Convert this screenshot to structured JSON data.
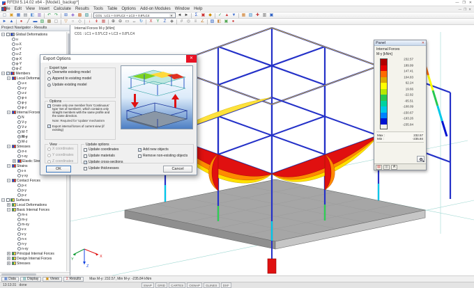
{
  "window": {
    "title": "RFEM 5.14.02 x64 - [Model1_backup*]",
    "minimize": "—",
    "maximize": "❐",
    "close": "✕"
  },
  "menu": {
    "items": [
      "File",
      "Edit",
      "View",
      "Insert",
      "Calculate",
      "Results",
      "Tools",
      "Table",
      "Options",
      "Add-on Modules",
      "Window",
      "Help"
    ]
  },
  "toolbar1_left": [
    {
      "n": "new-file",
      "g": "▢",
      "c": "#7d8da0"
    },
    {
      "n": "open-file",
      "g": "▣",
      "c": "#d99e2b"
    },
    {
      "n": "save-file",
      "g": "▦",
      "c": "#2f62c4"
    },
    {
      "n": "print",
      "g": "▤",
      "c": "#6f7780"
    },
    {
      "n": "copy",
      "g": "◧",
      "c": "#5b8fd4"
    },
    {
      "n": "paste",
      "g": "▥",
      "c": "#8c6fc4"
    },
    {
      "n": "sep"
    },
    {
      "n": "undo",
      "g": "↶",
      "c": "#2e9e4f"
    },
    {
      "n": "redo",
      "g": "↷",
      "c": "#2e9e4f"
    },
    {
      "n": "sep"
    },
    {
      "n": "new-model",
      "g": "⊞",
      "c": "#2f62c4"
    },
    {
      "n": "render-mode",
      "g": "◈",
      "c": "#7a52cc"
    },
    {
      "n": "tables",
      "g": "▩",
      "c": "#cf6a2e"
    },
    {
      "n": "display-properties",
      "g": "▨",
      "c": "#2e8f8f"
    },
    {
      "n": "sep"
    }
  ],
  "toolbar1": {
    "load_case": "CO1 : LC1 + 0.5*LC2 + LC3 + 0.8*LC4"
  },
  "toolbar1_right": [
    {
      "n": "previous-load-case",
      "g": "◄",
      "c": "#444444"
    },
    {
      "n": "next-load-case",
      "g": "►",
      "c": "#444444"
    },
    {
      "n": "sep"
    },
    {
      "n": "calculate",
      "g": "Σ",
      "c": "#2255cc"
    },
    {
      "n": "show-results",
      "g": "▣",
      "c": "#cc3333"
    },
    {
      "n": "show-loads",
      "g": "◆",
      "c": "#cc8800"
    },
    {
      "n": "sep"
    },
    {
      "n": "apply-results",
      "g": "✓",
      "c": "#2e9e4f"
    },
    {
      "n": "increase-values",
      "g": "▲",
      "c": "#d04040"
    },
    {
      "n": "decrease-values",
      "g": "▼",
      "c": "#4070d0"
    },
    {
      "n": "sep"
    },
    {
      "n": "panel-toggle",
      "g": "▦",
      "c": "#d08030"
    },
    {
      "n": "legend-toggle",
      "g": "▧",
      "c": "#4090d0"
    },
    {
      "n": "add-on-modules",
      "g": "✚",
      "c": "#c03030"
    },
    {
      "n": "misc-options",
      "g": "▥",
      "c": "#666666"
    },
    {
      "n": "help-tool",
      "g": "▣",
      "c": "#2f62c4"
    }
  ],
  "toolbar2": [
    {
      "n": "select-arrow",
      "g": "►",
      "c": "#2f62c4"
    },
    {
      "n": "select-special",
      "g": "▲",
      "c": "#2f62c4"
    },
    {
      "n": "sep"
    },
    {
      "n": "new-node",
      "g": "●",
      "c": "#cc4444"
    },
    {
      "n": "new-line",
      "g": "╱",
      "c": "#555555"
    },
    {
      "n": "new-member",
      "g": "▬",
      "c": "#2f62c4"
    },
    {
      "n": "new-surface",
      "g": "▧",
      "c": "#2e9e4f"
    },
    {
      "n": "new-solid",
      "g": "▩",
      "c": "#8a6f3a"
    },
    {
      "n": "new-opening",
      "g": "▢",
      "c": "#888888"
    },
    {
      "n": "sep"
    },
    {
      "n": "new-support",
      "g": "▽",
      "c": "#c87f2e"
    },
    {
      "n": "new-hinge",
      "g": "○",
      "c": "#777777"
    },
    {
      "n": "eccentricity",
      "g": "◇",
      "c": "#777777"
    },
    {
      "n": "sep"
    },
    {
      "n": "nodal-load",
      "g": "↓",
      "c": "#cc2222"
    },
    {
      "n": "member-load",
      "g": "↡",
      "c": "#cc2222"
    },
    {
      "n": "area-load",
      "g": "▦",
      "c": "#cc6666"
    },
    {
      "n": "sep"
    },
    {
      "n": "zoom-in",
      "g": "⊕",
      "c": "#444444"
    },
    {
      "n": "zoom-out",
      "g": "⊖",
      "c": "#444444"
    },
    {
      "n": "zoom-window",
      "g": "▭",
      "c": "#444444"
    },
    {
      "n": "pan",
      "g": "↔",
      "c": "#444444"
    },
    {
      "n": "rotate-view",
      "g": "↻",
      "c": "#2e7fd0"
    },
    {
      "n": "sep"
    },
    {
      "n": "view-x",
      "g": "X",
      "c": "#cc3333"
    },
    {
      "n": "view-y",
      "g": "Y",
      "c": "#2e9e4f"
    },
    {
      "n": "view-z",
      "g": "Z",
      "c": "#2f62c4"
    },
    {
      "n": "view-isometric",
      "g": "◆",
      "c": "#888888"
    },
    {
      "n": "sep"
    },
    {
      "n": "grid",
      "g": "#",
      "c": "#888888"
    },
    {
      "n": "snap",
      "g": "◎",
      "c": "#888888"
    },
    {
      "n": "guidelines",
      "g": "≡",
      "c": "#888888"
    },
    {
      "n": "dimensions",
      "g": "∠",
      "c": "#c87f2e"
    },
    {
      "n": "sep"
    },
    {
      "n": "visibilities",
      "g": "▨",
      "c": "#2f62c4"
    },
    {
      "n": "clipping",
      "g": "◧",
      "c": "#cc8844"
    },
    {
      "n": "rendering",
      "g": "▣",
      "c": "#55aa55"
    },
    {
      "n": "result-colors",
      "g": "●",
      "c": "#d04040"
    }
  ],
  "navigator": {
    "title": "Project Navigator - Results",
    "tree": [
      {
        "d": 0,
        "e": "-",
        "c": "check",
        "on": false,
        "t": "Global Deformations",
        "ic": "g"
      },
      {
        "d": 1,
        "c": "radio",
        "on": false,
        "t": "u"
      },
      {
        "d": 1,
        "c": "radio",
        "on": false,
        "t": "u-X"
      },
      {
        "d": 1,
        "c": "radio",
        "on": false,
        "t": "u-Y"
      },
      {
        "d": 1,
        "c": "radio",
        "on": false,
        "t": "u-Z"
      },
      {
        "d": 1,
        "c": "radio",
        "on": false,
        "t": "φ-X"
      },
      {
        "d": 1,
        "c": "radio",
        "on": false,
        "t": "φ-Y"
      },
      {
        "d": 1,
        "c": "radio",
        "on": false,
        "t": "φ-Z"
      },
      {
        "d": 0,
        "e": "-",
        "c": "check",
        "on": true,
        "t": "Members",
        "ic": "m"
      },
      {
        "d": 1,
        "e": "-",
        "t": "Local Deformations",
        "ic": "m"
      },
      {
        "d": 2,
        "c": "radio",
        "on": false,
        "t": "u-x"
      },
      {
        "d": 2,
        "c": "radio",
        "on": false,
        "t": "u-y"
      },
      {
        "d": 2,
        "c": "radio",
        "on": false,
        "t": "u-z"
      },
      {
        "d": 2,
        "c": "radio",
        "on": false,
        "t": "φ-x"
      },
      {
        "d": 2,
        "c": "radio",
        "on": false,
        "t": "φ-y"
      },
      {
        "d": 2,
        "c": "radio",
        "on": false,
        "t": "φ-z"
      },
      {
        "d": 1,
        "e": "-",
        "t": "Internal Forces",
        "ic": "m"
      },
      {
        "d": 2,
        "c": "radio",
        "on": false,
        "t": "N"
      },
      {
        "d": 2,
        "c": "radio",
        "on": false,
        "t": "V-y"
      },
      {
        "d": 2,
        "c": "radio",
        "on": false,
        "t": "V-z"
      },
      {
        "d": 2,
        "c": "radio",
        "on": false,
        "t": "M-T"
      },
      {
        "d": 2,
        "c": "radio",
        "on": true,
        "t": "M-y"
      },
      {
        "d": 2,
        "c": "radio",
        "on": false,
        "t": "M-z"
      },
      {
        "d": 1,
        "e": "-",
        "t": "Stresses",
        "ic": "m"
      },
      {
        "d": 2,
        "c": "radio",
        "on": false,
        "t": "σ-x"
      },
      {
        "d": 2,
        "c": "radio",
        "on": false,
        "t": "τ-xy"
      },
      {
        "d": 2,
        "e": "+",
        "t": "Elastic Stresses",
        "ic": "m"
      },
      {
        "d": 1,
        "e": "-",
        "t": "Strains",
        "ic": "m"
      },
      {
        "d": 2,
        "c": "radio",
        "on": false,
        "t": "ε-x"
      },
      {
        "d": 2,
        "c": "radio",
        "on": false,
        "t": "γ-xy"
      },
      {
        "d": 1,
        "e": "-",
        "t": "Contact Forces",
        "ic": "m"
      },
      {
        "d": 2,
        "c": "radio",
        "on": false,
        "t": "p-x"
      },
      {
        "d": 2,
        "c": "radio",
        "on": false,
        "t": "p-y"
      },
      {
        "d": 2,
        "c": "radio",
        "on": false,
        "t": "p-z"
      },
      {
        "d": 0,
        "e": "-",
        "c": "check",
        "on": false,
        "t": "Surfaces",
        "ic": "s"
      },
      {
        "d": 1,
        "e": "+",
        "t": "Local Deformations",
        "ic": "s"
      },
      {
        "d": 1,
        "e": "-",
        "t": "Basic Internal Forces",
        "ic": "s"
      },
      {
        "d": 2,
        "c": "radio",
        "on": false,
        "t": "m-x"
      },
      {
        "d": 2,
        "c": "radio",
        "on": false,
        "t": "m-y"
      },
      {
        "d": 2,
        "c": "radio",
        "on": false,
        "t": "m-xy"
      },
      {
        "d": 2,
        "c": "radio",
        "on": false,
        "t": "v-x"
      },
      {
        "d": 2,
        "c": "radio",
        "on": false,
        "t": "v-y"
      },
      {
        "d": 2,
        "c": "radio",
        "on": false,
        "t": "n-x"
      },
      {
        "d": 2,
        "c": "radio",
        "on": false,
        "t": "n-y"
      },
      {
        "d": 2,
        "c": "radio",
        "on": false,
        "t": "n-xy"
      },
      {
        "d": 1,
        "e": "+",
        "t": "Principal Internal Forces",
        "ic": "s"
      },
      {
        "d": 1,
        "e": "+",
        "t": "Design Internal Forces",
        "ic": "s"
      },
      {
        "d": 1,
        "e": "+",
        "t": "Stresses",
        "ic": "s"
      }
    ]
  },
  "viewport": {
    "overlay1": "Internal Forces M-y [kNm]",
    "overlay2": "CO1 : LC1 + 0.5*LC2 + LC3 + 0.8*LC4",
    "axis_x": "X",
    "axis_y": "Y",
    "axis_z": "Z"
  },
  "panel": {
    "title": "Panel",
    "close": "✕",
    "subtitle1": "Internal Forces",
    "subtitle2": "M-y [kNm]",
    "scale_colors": [
      "#b00000",
      "#e80000",
      "#ff6a00",
      "#dcaa00",
      "#ffff00",
      "#b8e800",
      "#28c850",
      "#00d2a0",
      "#00c8e8",
      "#0082ff",
      "#0014d2"
    ],
    "scale_values": [
      "232.57",
      "189.99",
      "147.41",
      "104.83",
      "62.24",
      "19.66",
      "-22.92",
      "-65.51",
      "-108.09",
      "-150.67",
      "-193.26",
      "-235.84"
    ],
    "max_label": "Max :",
    "max_value": "232.57",
    "min_label": "Min :",
    "min_value": "-235.84",
    "tabs": [
      {
        "n": "panel-tab-color-scale",
        "g": "▤",
        "c": "#cc3333"
      },
      {
        "n": "panel-tab-factors",
        "g": "▥",
        "c": "#888888"
      },
      {
        "n": "panel-tab-filter",
        "g": "A",
        "c": "#333333"
      }
    ]
  },
  "dialog": {
    "title": "Export Options",
    "close": "✕",
    "export_type": {
      "label": "Export type",
      "opt1": "Overwrite existing model",
      "opt2": "Append to existing model",
      "opt3": "Update existing model",
      "opt1_on": false,
      "opt2_on": false,
      "opt3_on": true
    },
    "options": {
      "label": "Options",
      "check1": "Create only one member from 'Continuous' type 'Set of members', which contains only straight members with the same profile and the same direction.",
      "check1_on": true,
      "note": "Note: Required for 'Update' mechanism",
      "check2": "Export internal forces of current view (if existing)",
      "check2_on": true
    },
    "view_group": {
      "label": "View",
      "opt1": "X coordinates",
      "opt2": "Y coordinates",
      "opt3": "Z coordinates"
    },
    "update_options": {
      "label": "Update options",
      "c1": "Update coordinates",
      "c1_on": false,
      "c2": "Update materials",
      "c2_on": false,
      "c3": "Update cross-sections",
      "c3_on": true,
      "c4": "Update thicknesses",
      "c4_on": false,
      "c5": "Add new objects",
      "c5_on": true,
      "c6": "Remove non-existing objects",
      "c6_on": false
    },
    "ok": "OK",
    "cancel": "Cancel"
  },
  "statusbar": {
    "tabs": [
      {
        "n": "tab-data",
        "t": "Data",
        "g": "▦",
        "c": "#2f62c4"
      },
      {
        "n": "tab-display",
        "t": "Display",
        "g": "▥",
        "c": "#2e8f8f"
      },
      {
        "n": "tab-views",
        "t": "Views",
        "g": "▣",
        "c": "#cc8800"
      },
      {
        "n": "tab-results",
        "t": "Results",
        "g": "Σ",
        "c": "#cc3333"
      }
    ],
    "message": "Max M-y: 232.57, Min M-y: -235.84 kNm",
    "time": "13:13:31",
    "state": "done",
    "toggles": [
      "SNAP",
      "GRID",
      "CARTES",
      "OSNAP",
      "GLINES",
      "DXF"
    ]
  }
}
